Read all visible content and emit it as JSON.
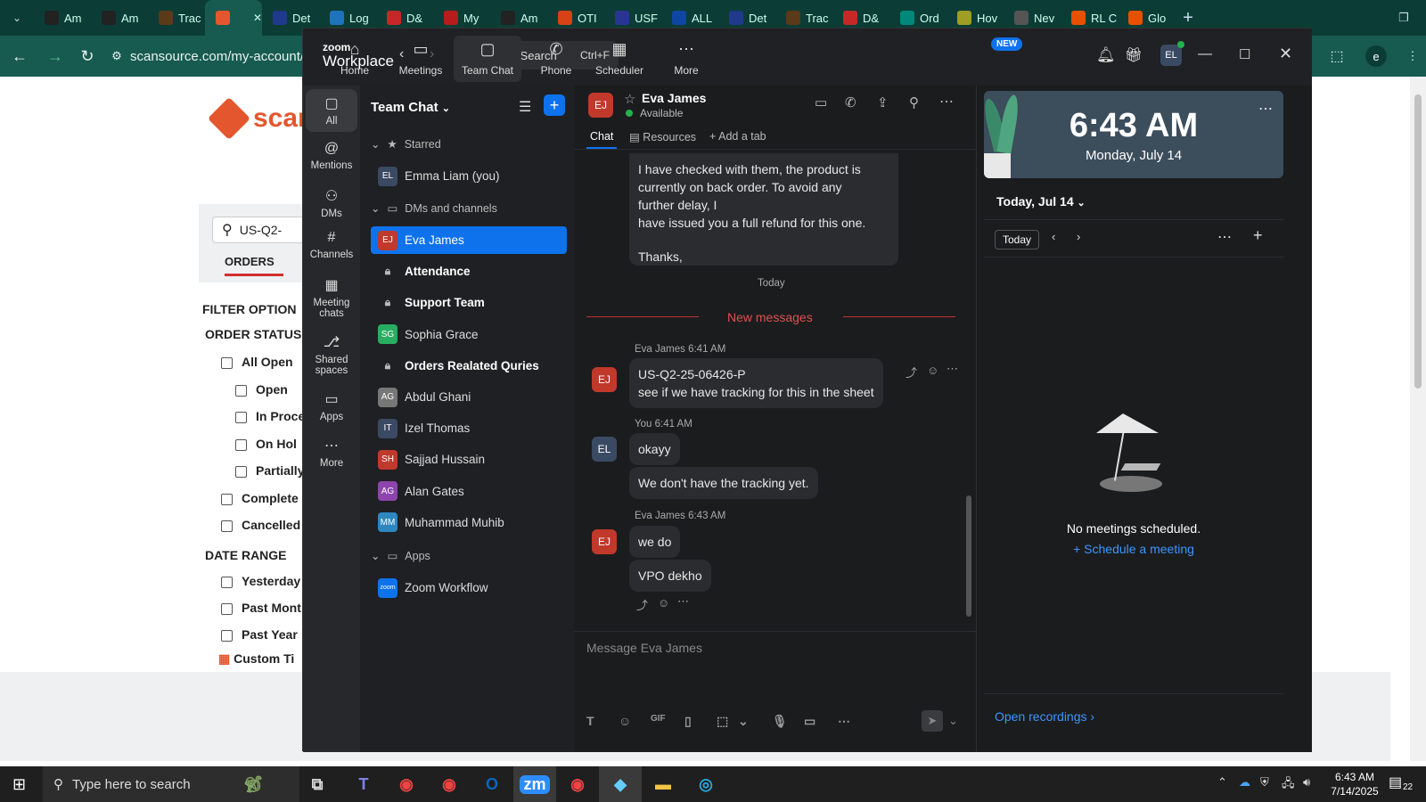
{
  "browser": {
    "tabs": [
      {
        "label": "Am",
        "fav_color": "#222"
      },
      {
        "label": "Am",
        "fav_color": "#222"
      },
      {
        "label": "Trac",
        "fav_color": "#5b3a1a"
      },
      {
        "label": "",
        "fav_color": "#e4572e",
        "active": true
      },
      {
        "label": "Det",
        "fav_color": "#1f3a8a"
      },
      {
        "label": "Log",
        "fav_color": "#1e73be"
      },
      {
        "label": "D&",
        "fav_color": "#c62828"
      },
      {
        "label": "My",
        "fav_color": "#b71c1c"
      },
      {
        "label": "Am",
        "fav_color": "#222"
      },
      {
        "label": "OTI",
        "fav_color": "#d84315"
      },
      {
        "label": "USF",
        "fav_color": "#283593"
      },
      {
        "label": "ALL",
        "fav_color": "#0d47a1"
      },
      {
        "label": "Det",
        "fav_color": "#1f3a8a"
      },
      {
        "label": "Trac",
        "fav_color": "#5b3a1a"
      },
      {
        "label": "D&",
        "fav_color": "#c62828"
      },
      {
        "label": "Ord",
        "fav_color": "#00897b"
      },
      {
        "label": "Hov",
        "fav_color": "#9e9d24"
      },
      {
        "label": "Nev",
        "fav_color": "#555"
      },
      {
        "label": "RL C",
        "fav_color": "#e65100"
      },
      {
        "label": "Glo",
        "fav_color": "#e65100"
      }
    ],
    "url": "scansource.com/my-account/",
    "profile_initial": "e"
  },
  "webpage": {
    "logo_text": "scan",
    "search_value": "US-Q2-",
    "orders_tab": "ORDERS",
    "filter_heading": "FILTER OPTION",
    "order_status_heading": "ORDER STATUS",
    "order_status_options": [
      "All Open",
      "Open",
      "In Proce",
      "On Hol",
      "Partially",
      "Complete",
      "Cancelled"
    ],
    "date_range_heading": "DATE RANGE",
    "date_options": [
      "Yesterday",
      "Past Mont",
      "Past Year"
    ],
    "custom_time": "Custom Ti"
  },
  "zoom": {
    "brand_top": "zoom",
    "brand_bottom": "Workplace",
    "search_label": "Search",
    "search_shortcut": "Ctrl+F",
    "nav": [
      "Home",
      "Meetings",
      "Team Chat",
      "Phone",
      "Scheduler",
      "More"
    ],
    "new_badge": "NEW",
    "user_initials": "EL",
    "rail": [
      "All",
      "Mentions",
      "DMs",
      "Channels",
      "Meeting chats",
      "Shared spaces",
      "Apps",
      "More"
    ],
    "list_title": "Team Chat",
    "sections": {
      "starred": "Starred",
      "dms": "DMs and channels",
      "apps": "Apps"
    },
    "starred_items": [
      {
        "name": "Emma Liam (you)",
        "initials": "EL",
        "color": "#3b4a63"
      }
    ],
    "dm_items": [
      {
        "name": "Eva James",
        "initials": "EJ",
        "color": "#c0392b"
      },
      {
        "name": "Attendance",
        "lock": true,
        "bold": true
      },
      {
        "name": "Support Team",
        "lock": true,
        "bold": true
      },
      {
        "name": "Sophia Grace",
        "initials": "SG",
        "color": "#27ae60"
      },
      {
        "name": "Orders Realated Quries",
        "lock": true,
        "bold": true
      },
      {
        "name": "Abdul Ghani",
        "initials": "AG",
        "color": "#777"
      },
      {
        "name": "Izel Thomas",
        "initials": "IT",
        "color": "#3b4a63"
      },
      {
        "name": "Sajjad Hussain",
        "initials": "SH",
        "color": "#c0392b"
      },
      {
        "name": "Alan Gates",
        "initials": "AG",
        "color": "#8e44ad"
      },
      {
        "name": "Muhammad Muhib",
        "initials": "MM",
        "color": "#2e86c1"
      }
    ],
    "app_items": [
      {
        "name": "Zoom Workflow",
        "initials": "zoom",
        "color": "#0e72ed"
      }
    ],
    "chat": {
      "contact_name": "Eva James",
      "contact_initials": "EJ",
      "status": "Available",
      "tabs": [
        "Chat",
        "Resources",
        "Add a tab"
      ],
      "earlier_message": [
        "I have checked with them, the product is",
        "currently on back order. To avoid any",
        "further delay, I",
        "have issued you a full refund for this one.",
        "",
        "Thanks,"
      ],
      "date_divider": "Today",
      "new_messages_label": "New messages",
      "messages": [
        {
          "sender": "Eva James",
          "time": "6:41 AM",
          "initials": "EJ",
          "lines": [
            "US-Q2-25-06426-P",
            "see if we have tracking for this in the sheet"
          ]
        },
        {
          "sender": "You",
          "time": "6:41 AM",
          "initials": "EL",
          "lines": [
            "okayy"
          ]
        },
        {
          "sender": "You",
          "time": "",
          "initials": "",
          "lines": [
            "We don't have the tracking yet."
          ]
        },
        {
          "sender": "Eva James",
          "time": "6:43 AM",
          "initials": "EJ",
          "lines": [
            "we do"
          ]
        },
        {
          "sender": "Eva James",
          "time": "",
          "initials": "",
          "lines": [
            "VPO dekho"
          ]
        }
      ],
      "composer_placeholder": "Message Eva James"
    },
    "calendar": {
      "time": "6:43 AM",
      "date": "Monday, July 14",
      "day_selector": "Today, Jul 14",
      "today_button": "Today",
      "empty_text": "No meetings scheduled.",
      "schedule_link": "Schedule a meeting",
      "open_recordings": "Open recordings"
    }
  },
  "taskbar": {
    "search_placeholder": "Type here to search",
    "clock_time": "6:43 AM",
    "clock_date": "7/14/2025",
    "notification_count": "22"
  }
}
